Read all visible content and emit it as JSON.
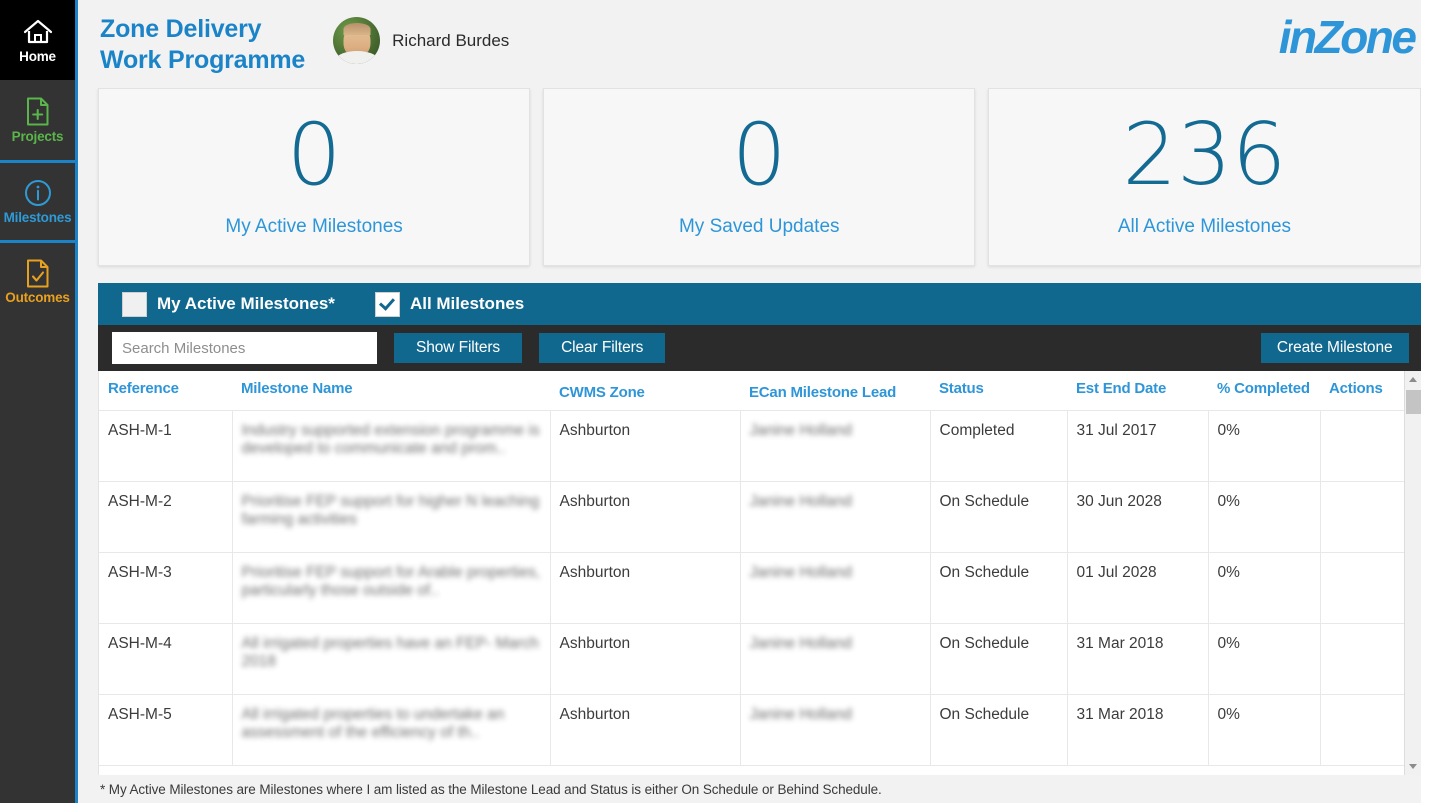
{
  "sidebar": {
    "items": [
      {
        "label": "Home",
        "icon": "home-icon",
        "color": "#ffffff"
      },
      {
        "label": "Projects",
        "icon": "file-plus-icon",
        "color": "#5ab54a"
      },
      {
        "label": "Milestones",
        "icon": "info-icon",
        "color": "#2e9ad6"
      },
      {
        "label": "Outcomes",
        "icon": "file-check-icon",
        "color": "#e8a020"
      }
    ]
  },
  "header": {
    "title_line1": "Zone Delivery",
    "title_line2": "Work Programme",
    "user_name": "Richard Burdes",
    "avatar_icon": "user-avatar-photo",
    "logo_text": "inZone",
    "brand_color": "#2e96d8"
  },
  "cards": [
    {
      "value": "0",
      "label": "My Active Milestones"
    },
    {
      "value": "0",
      "label": "My Saved Updates"
    },
    {
      "value": "236",
      "label": "All Active Milestones"
    }
  ],
  "filters": {
    "my_active_label": "My Active Milestones*",
    "my_active_checked": false,
    "all_label": "All Milestones",
    "all_checked": true,
    "search_placeholder": "Search Milestones",
    "search_value": "",
    "show_filters_label": "Show Filters",
    "clear_filters_label": "Clear Filters",
    "create_label": "Create Milestone",
    "bar_color": "#11688e"
  },
  "table": {
    "columns": [
      "Reference",
      "Milestone Name",
      "CWMS Zone",
      "ECan Milestone Lead",
      "Status",
      "Est End Date",
      "% Completed",
      "Actions"
    ],
    "rows": [
      {
        "reference": "ASH-M-1",
        "name": "Industry supported extension programme is developed to communicate and prom..",
        "zone": "Ashburton",
        "lead": "Janine Holland",
        "status": "Completed",
        "est_end_date": "31 Jul 2017",
        "pct_completed": "0%",
        "actions": ""
      },
      {
        "reference": "ASH-M-2",
        "name": "Prioritise FEP support for higher N leaching farming activities",
        "zone": "Ashburton",
        "lead": "Janine Holland",
        "status": "On Schedule",
        "est_end_date": "30 Jun 2028",
        "pct_completed": "0%",
        "actions": ""
      },
      {
        "reference": "ASH-M-3",
        "name": "Prioritise FEP support for Arable properties, particularly those outside of..",
        "zone": "Ashburton",
        "lead": "Janine Holland",
        "status": "On Schedule",
        "est_end_date": "01 Jul 2028",
        "pct_completed": "0%",
        "actions": ""
      },
      {
        "reference": "ASH-M-4",
        "name": "All irrigated properties have an FEP- March 2018",
        "zone": "Ashburton",
        "lead": "Janine Holland",
        "status": "On Schedule",
        "est_end_date": "31 Mar 2018",
        "pct_completed": "0%",
        "actions": ""
      },
      {
        "reference": "ASH-M-5",
        "name": "All irrigated properties to undertake an assessment of the efficiency of th..",
        "zone": "Ashburton",
        "lead": "Janine Holland",
        "status": "On Schedule",
        "est_end_date": "31 Mar 2018",
        "pct_completed": "0%",
        "actions": ""
      }
    ]
  },
  "footnote": "* My Active Milestones are Milestones where I am listed as the Milestone Lead and Status is either On Schedule or Behind Schedule."
}
